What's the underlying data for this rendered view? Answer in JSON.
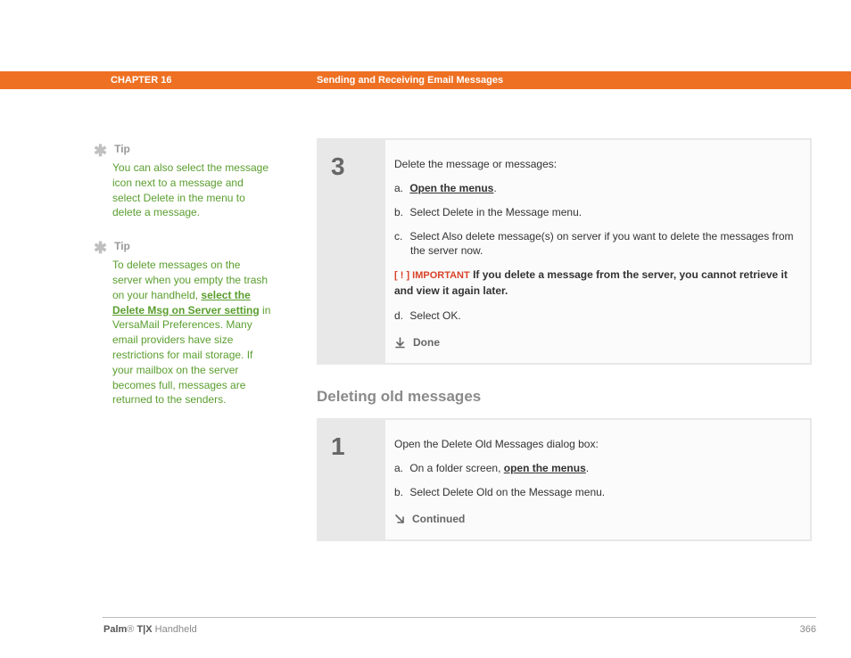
{
  "header": {
    "chapter": "CHAPTER 16",
    "title": "Sending and Receiving Email Messages"
  },
  "tips": [
    {
      "label": "Tip",
      "body_before": "You can also select the message icon next to a message and select Delete in the menu to delete a message.",
      "link": "",
      "body_after": ""
    },
    {
      "label": "Tip",
      "body_before": "To delete messages on the server when you empty the trash on your handheld, ",
      "link": "select the Delete Msg on Server setting",
      "body_after": " in VersaMail Preferences. Many email providers have size restrictions for mail storage. If your mailbox on the server becomes full, messages are returned to the senders."
    }
  ],
  "step3": {
    "number": "3",
    "intro": "Delete the message or messages:",
    "items": [
      {
        "marker": "a.",
        "before": "",
        "link": "Open the menus",
        "after": "."
      },
      {
        "marker": "b.",
        "before": "Select Delete in the Message menu.",
        "link": "",
        "after": ""
      },
      {
        "marker": "c.",
        "before": "Select Also delete message(s) on server if you want to delete the messages from the server now.",
        "link": "",
        "after": ""
      }
    ],
    "important_tag": "[ ! ] IMPORTANT",
    "important_text": " If you delete a message from the server, you cannot retrieve it and view it again later.",
    "item_d": {
      "marker": "d.",
      "text": "Select OK."
    },
    "done": "Done"
  },
  "section_heading": "Deleting old messages",
  "step1": {
    "number": "1",
    "intro": "Open the Delete Old Messages dialog box:",
    "items": [
      {
        "marker": "a.",
        "before": "On a folder screen, ",
        "link": "open the menus",
        "after": "."
      },
      {
        "marker": "b.",
        "before": "Select Delete Old on the Message menu.",
        "link": "",
        "after": ""
      }
    ],
    "continued": "Continued"
  },
  "footer": {
    "brand_bold": "Palm",
    "brand_reg": "®",
    "brand_model": " T|X",
    "brand_rest": " Handheld",
    "page": "366"
  }
}
